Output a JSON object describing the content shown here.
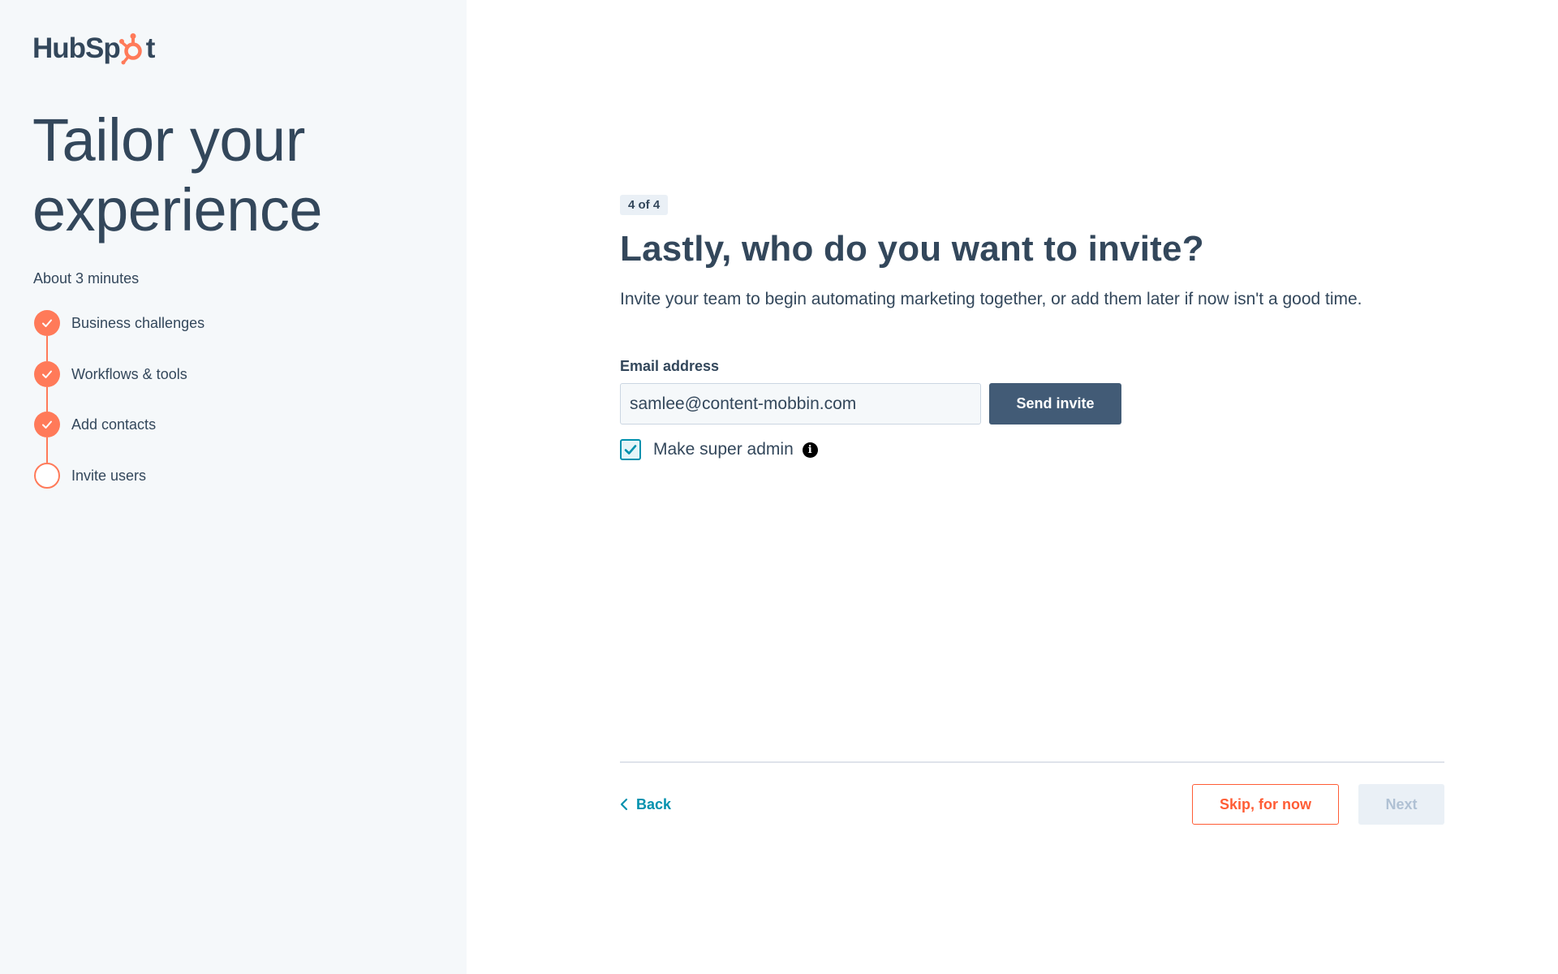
{
  "brand": {
    "logo_text_before": "HubSp",
    "logo_text_after": "t",
    "accent_color": "#ff7a59",
    "text_color": "#33475b"
  },
  "sidebar": {
    "heading": "Tailor your experience",
    "duration": "About 3 minutes",
    "steps": [
      {
        "label": "Business challenges",
        "completed": true
      },
      {
        "label": "Workflows & tools",
        "completed": true
      },
      {
        "label": "Add contacts",
        "completed": true
      },
      {
        "label": "Invite users",
        "completed": false
      }
    ]
  },
  "main": {
    "progress_badge": "4 of 4",
    "title": "Lastly, who do you want to invite?",
    "subtitle": "Invite your team to begin automating marketing together, or add them later if now isn't a good time.",
    "email_label": "Email address",
    "email_value": "samlee@content-mobbin.com",
    "send_invite_label": "Send invite",
    "super_admin_label": "Make super admin",
    "super_admin_checked": true
  },
  "footer": {
    "back_label": "Back",
    "skip_label": "Skip, for now",
    "next_label": "Next"
  }
}
